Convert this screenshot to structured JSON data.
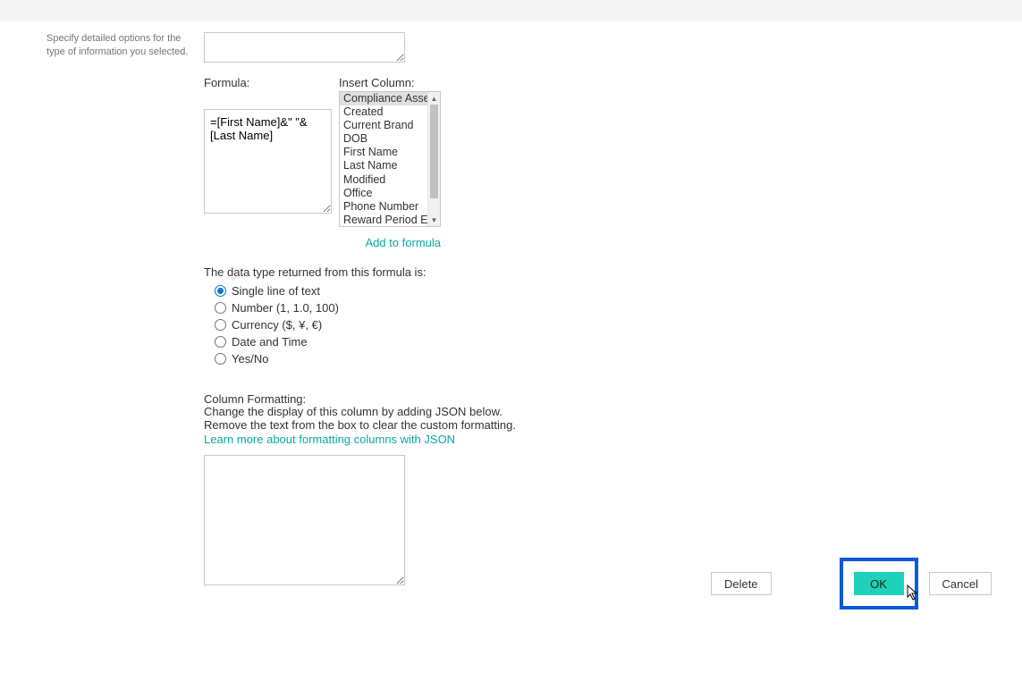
{
  "sidebar": {
    "help_text": "Specify detailed options for the type of information you selected."
  },
  "description": {
    "value": ""
  },
  "formula": {
    "label": "Formula:",
    "value": "=[First Name]&\" \"&[Last Name]"
  },
  "insert_column": {
    "label": "Insert Column:",
    "items": [
      "Compliance Asset Id",
      "Created",
      "Current Brand",
      "DOB",
      "First Name",
      "Last Name",
      "Modified",
      "Office",
      "Phone Number",
      "Reward Period End"
    ],
    "selected_index": 0,
    "add_link": "Add to formula"
  },
  "datatype": {
    "label": "The data type returned from this formula is:",
    "options": [
      "Single line of text",
      "Number (1, 1.0, 100)",
      "Currency ($, ¥, €)",
      "Date and Time",
      "Yes/No"
    ],
    "selected_index": 0
  },
  "column_formatting": {
    "label": "Column Formatting:",
    "desc_line1": "Change the display of this column by adding JSON below.",
    "desc_line2": "Remove the text from the box to clear the custom formatting.",
    "link": "Learn more about formatting columns with JSON",
    "value": ""
  },
  "buttons": {
    "delete": "Delete",
    "ok": "OK",
    "cancel": "Cancel"
  }
}
